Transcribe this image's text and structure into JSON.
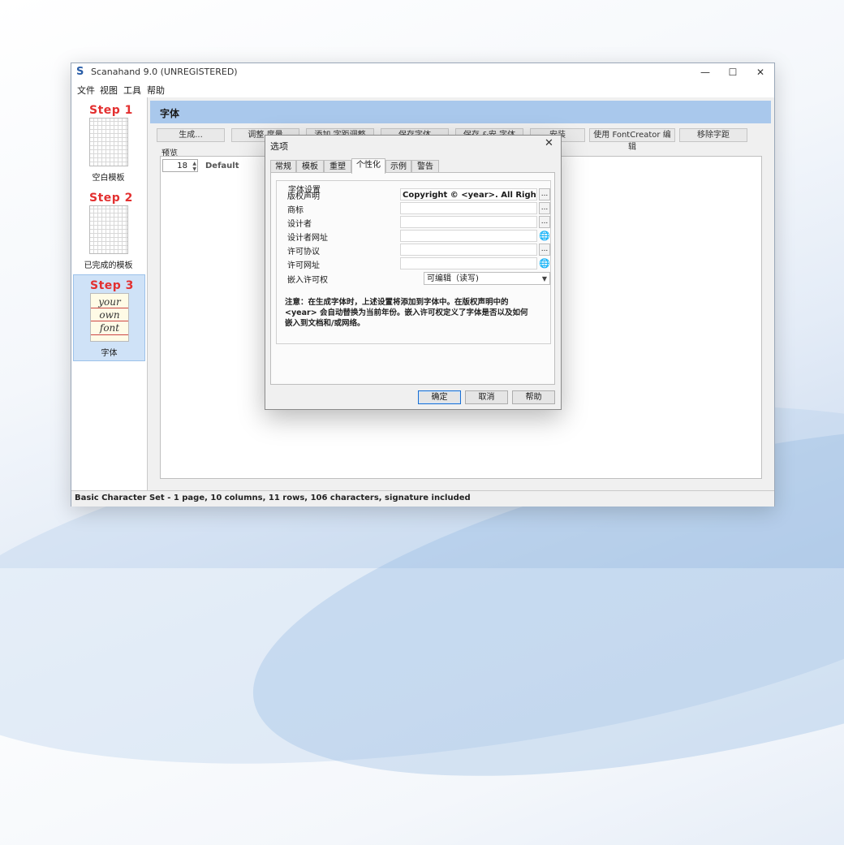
{
  "app": {
    "title": "Scanahand 9.0 (UNREGISTERED)",
    "win_minimize": "—",
    "win_maximize": "☐",
    "win_close": "✕"
  },
  "menu": [
    "文件",
    "视图",
    "工具",
    "帮助"
  ],
  "sidebar": {
    "steps": [
      {
        "title": "Step 1",
        "label": "空白模板"
      },
      {
        "title": "Step 2",
        "label": "已完成的模板"
      },
      {
        "title": "Step 3",
        "label": "字体",
        "thumb_words": [
          "your",
          "own",
          "font"
        ]
      }
    ]
  },
  "main": {
    "header": "字体",
    "toolbar": [
      "生成...",
      "调整 度量",
      "添加 字距调整",
      "保存字体",
      "保存 &安 字体",
      "安装",
      "使用 FontCreator 编辑",
      "移除字距"
    ],
    "preview_label": "预览",
    "size_value": "18",
    "font_name": "Default"
  },
  "status": "Basic Character Set - 1 page, 10 columns, 11 rows, 106 characters, signature included",
  "dialog": {
    "title": "选项",
    "close": "✕",
    "tabs": [
      "常规",
      "模板",
      "重塑",
      "个性化",
      "示例",
      "警告"
    ],
    "active_tab": "个性化",
    "group_title": "字体设置",
    "fields": [
      {
        "label": "版权声明",
        "value": "Copyright © <year>. All Rights Reser",
        "button": "..."
      },
      {
        "label": "商标",
        "value": "",
        "button": "..."
      },
      {
        "label": "设计者",
        "value": "",
        "button": "..."
      },
      {
        "label": "设计者网址",
        "value": "",
        "button": "globe"
      },
      {
        "label": "许可协议",
        "value": "",
        "button": "..."
      },
      {
        "label": "许可网址",
        "value": "",
        "button": "globe"
      }
    ],
    "embed_label": "嵌入许可权",
    "embed_value": "可编辑（读写)",
    "note_lines": [
      "注意：在生成字体时，上述设置将添加到字体中。在版权声明中的",
      "<year> 会自动替换为当前年份。嵌入许可权定义了字体是否以及如何",
      "嵌入到文档和/或网络。"
    ],
    "buttons": {
      "ok": "确定",
      "cancel": "取消",
      "help": "帮助"
    }
  }
}
